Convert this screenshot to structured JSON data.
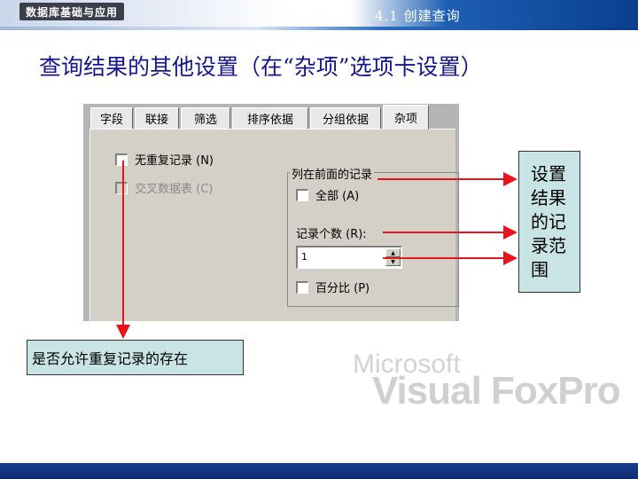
{
  "header": {
    "logo_text": "数据库基础与应用",
    "section_title": "4.1 创建查询"
  },
  "slide": {
    "title": "查询结果的其他设置（在“杂项”选项卡设置）"
  },
  "dialog": {
    "tabs": [
      {
        "label": "字段",
        "active": false
      },
      {
        "label": "联接",
        "active": false
      },
      {
        "label": "筛选",
        "active": false
      },
      {
        "label": "排序依据",
        "active": false
      },
      {
        "label": "分组依据",
        "active": false
      },
      {
        "label": "杂项",
        "active": true
      }
    ],
    "no_duplicates": {
      "label": "无重复记录 (N)",
      "checked": false
    },
    "crosstab": {
      "label": "交叉数据表 (C)",
      "checked": false,
      "disabled": true
    },
    "top_group": {
      "title": "列在前面的记录",
      "all": {
        "label": "全部 (A)",
        "checked": false
      },
      "count_label": "记录个数 (R):",
      "count_value": "1",
      "percent": {
        "label": "百分比 (P)",
        "checked": false
      }
    }
  },
  "callouts": {
    "right_lines": [
      "设置",
      "结果",
      "的记",
      "录范",
      "围"
    ],
    "bottom": "是否允许重复记录的存在"
  },
  "watermark": {
    "line1": "Microsoft",
    "line2": "Visual FoxPro"
  },
  "colors": {
    "title_blue": "#16168c",
    "callout_fill": "#c8e4e4",
    "arrow_red": "#e8141e",
    "footer_blue": "#0e2c73"
  }
}
